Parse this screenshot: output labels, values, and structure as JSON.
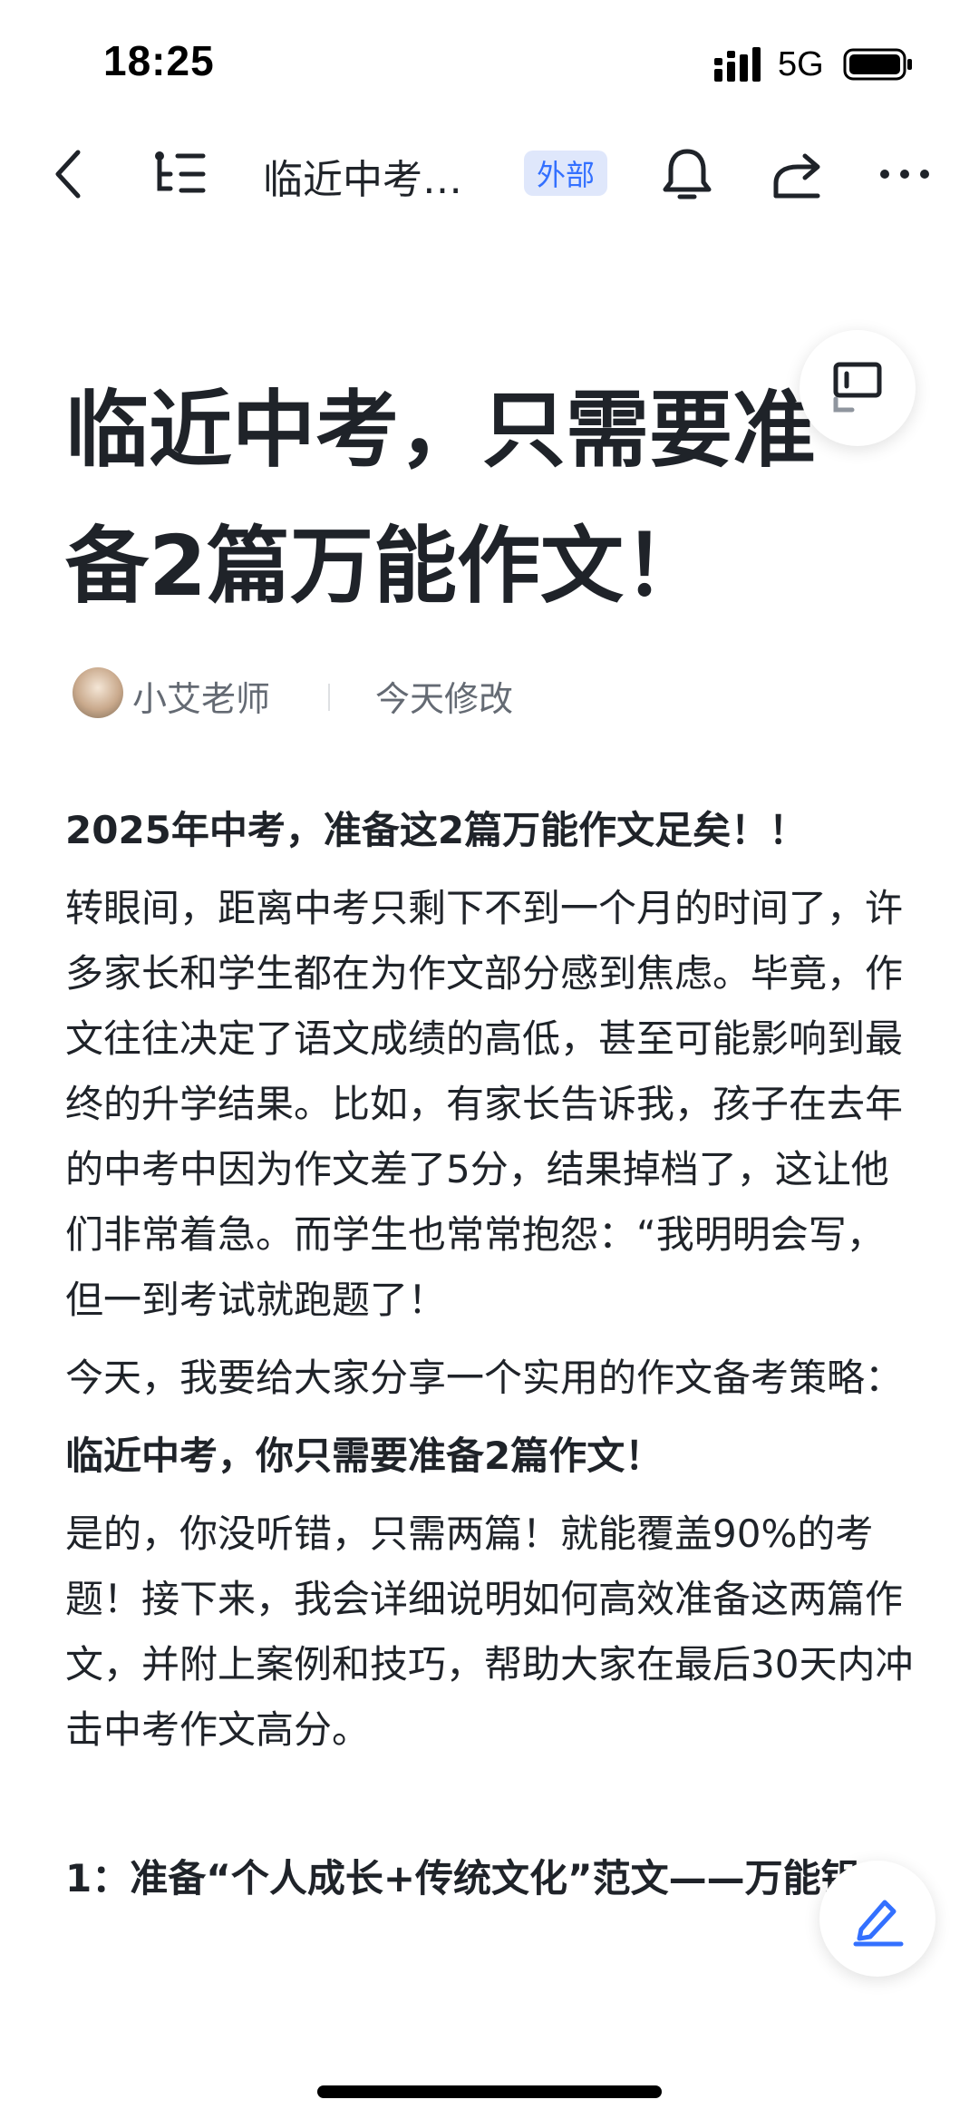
{
  "status_bar": {
    "time": "18:25",
    "network": "5G"
  },
  "nav": {
    "title": "临近中考…",
    "badge": "外部",
    "icons": [
      "back-icon",
      "toc-icon",
      "bell-icon",
      "share-icon",
      "more-icon"
    ]
  },
  "doc": {
    "title": "临近中考，只需要准备2篇万能作文！",
    "author": "小艾老师",
    "modified": "今天修改",
    "paragraphs": {
      "p1": "2025年中考，准备这2篇万能作文足矣！！",
      "p2": "转眼间，距离中考只剩下不到一个月的时间了，许多家长和学生都在为作文部分感到焦虑。毕竟，作文往往决定了语文成绩的高低，甚至可能影响到最终的升学结果。比如，有家长告诉我，孩子在去年的中考中因为作文差了5分，结果掉档了，这让他们非常着急。而学生也常常抱怨：“我明明会写，但一到考试就跑题了！",
      "p3": "今天，我要给大家分享一个实用的作文备考策略：",
      "p4": "临近中考，你只需要准备2篇作文！",
      "p5": "是的，你没听错，只需两篇！就能覆盖90%的考题！接下来，我会详细说明如何高效准备这两篇作文，并附上案例和技巧，帮助大家在最后30天内冲击中考作文高分。",
      "p6": "1：准备“个人成长+传统文化”范文——万能钥"
    }
  },
  "colors": {
    "accent": "#3370ff",
    "badge_bg": "#dfe7fb",
    "text": "#1f2329",
    "muted": "#646a73"
  }
}
